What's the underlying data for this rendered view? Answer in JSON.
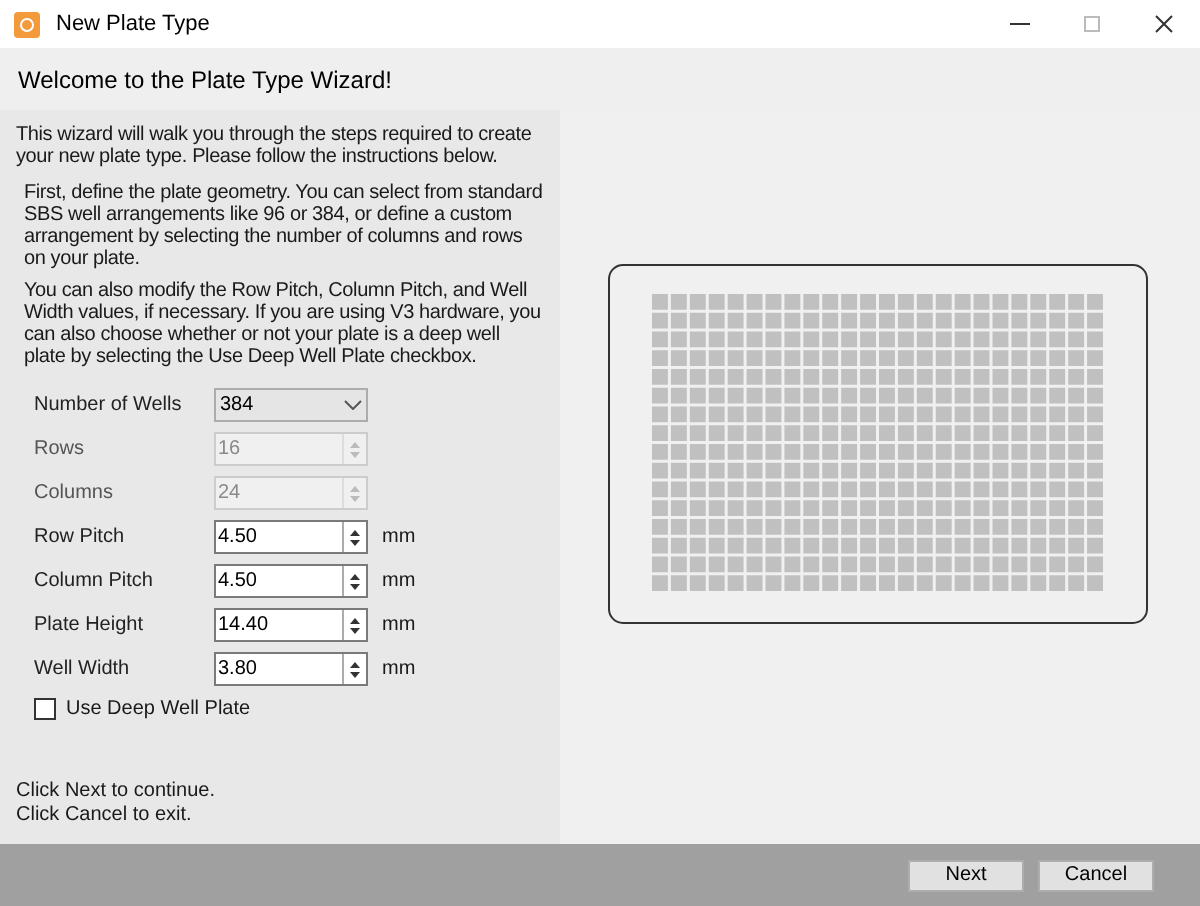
{
  "window": {
    "title": "New Plate Type"
  },
  "header": "Welcome to the Plate Type Wizard!",
  "intro": "This wizard will walk you through the steps required to create your new plate type. Please follow the instructions below.",
  "instructions": [
    "First, define the plate geometry. You can select from standard SBS well arrangements like 96 or 384, or define a custom arrangement by selecting the number of columns and rows on your plate.",
    "You can also modify the Row Pitch, Column Pitch, and Well Width values, if necessary. If you are using V3 hardware, you can also choose whether or not your plate is a deep well plate by selecting the Use Deep Well Plate checkbox."
  ],
  "fields": [
    {
      "kind": "dropdown",
      "label": "Number of Wells",
      "value": "384",
      "disabled": false
    },
    {
      "kind": "spinner",
      "label": "Rows",
      "value": "16",
      "disabled": true
    },
    {
      "kind": "spinner",
      "label": "Columns",
      "value": "24",
      "disabled": true
    },
    {
      "kind": "spinner",
      "label": "Row Pitch",
      "value": "4.50",
      "disabled": false,
      "unit": "mm"
    },
    {
      "kind": "spinner",
      "label": "Column Pitch",
      "value": "4.50",
      "disabled": false,
      "unit": "mm"
    },
    {
      "kind": "spinner",
      "label": "Plate Height",
      "value": "14.40",
      "disabled": false,
      "unit": "mm"
    },
    {
      "kind": "spinner",
      "label": "Well Width",
      "value": "3.80",
      "disabled": false,
      "unit": "mm"
    }
  ],
  "deep_well": {
    "label": "Use Deep Well Plate",
    "checked": false
  },
  "footer_notes": [
    "Click Next to continue.",
    "Click Cancel to exit."
  ],
  "buttons": [
    "Next",
    "Cancel"
  ]
}
